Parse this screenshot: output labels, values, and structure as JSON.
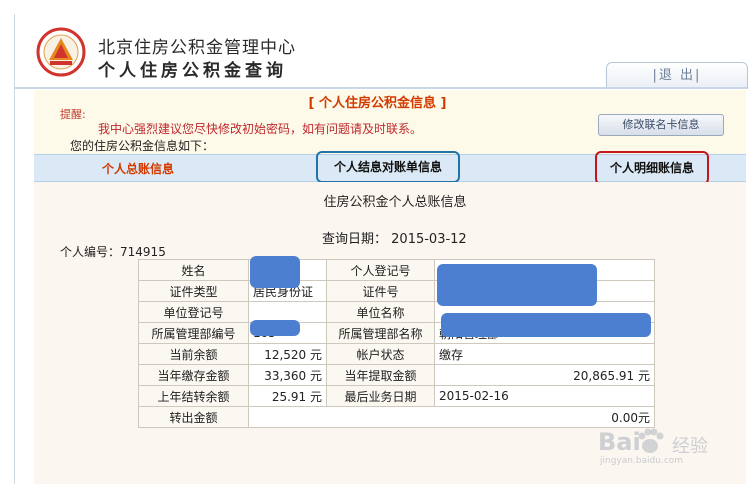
{
  "header": {
    "org_title": "北京住房公积金管理中心",
    "system_title": "个人住房公积金查询",
    "logout_label": "|退 出|"
  },
  "notice": {
    "section_title": "[ 个人住房公积金信息 ]",
    "prompt_label": "提醒:",
    "message": "我中心强烈建议您尽快修改初始密码，如有问题请及时联系。",
    "balance_intro": "您的住房公积金信息如下：",
    "edit_card_button": "修改联名卡信息"
  },
  "tabs": [
    {
      "label": "个人总账信息",
      "active": true
    },
    {
      "label": "个人结息对账单信息",
      "active": false
    },
    {
      "label": "个人明细账信息",
      "active": false
    }
  ],
  "report": {
    "title": "住房公积金个人总账信息",
    "query_date_label": "查询日期：",
    "query_date": "2015-03-12",
    "personal_no_label": "个人编号：",
    "personal_no": "714915"
  },
  "table": {
    "rows": [
      {
        "l1": "姓名",
        "v1": "",
        "l2": "个人登记号",
        "v2": ""
      },
      {
        "l1": "证件类型",
        "v1": "居民身份证",
        "l2": "证件号",
        "v2": ""
      },
      {
        "l1": "单位登记号",
        "v1": "",
        "l2": "单位名称",
        "v2": ""
      },
      {
        "l1": "所属管理部编号",
        "v1": "105",
        "l2": "所属管理部名称",
        "v2": "朝阳管理部"
      },
      {
        "l1": "当前余额",
        "v1": "12,520 元",
        "l2": "帐户状态",
        "v2": "缴存"
      },
      {
        "l1": "当年缴存金额",
        "v1": "33,360 元",
        "l2": "当年提取金额",
        "v2": "20,865.91 元"
      },
      {
        "l1": "上年结转余额",
        "v1": "25.91 元",
        "l2": "最后业务日期",
        "v2": "2015-02-16"
      }
    ],
    "last_row": {
      "label": "转出金额",
      "value": "0.00元"
    }
  },
  "watermark": {
    "brand": "Bai",
    "brand_suffix": "经验",
    "url": "jingyan.baidu.com"
  },
  "colors": {
    "accent_red": "#d23a00",
    "tab_band": "#dbe9f6",
    "mask_blue": "#4d7fd0",
    "highlight_blue": "#2273a8",
    "highlight_red": "#c4171d"
  }
}
